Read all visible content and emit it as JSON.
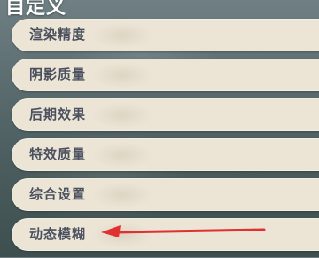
{
  "section": {
    "title": "自定义"
  },
  "menu": {
    "items": [
      {
        "label": "渲染精度"
      },
      {
        "label": "阴影质量"
      },
      {
        "label": "后期效果"
      },
      {
        "label": "特效质量"
      },
      {
        "label": "综合设置"
      },
      {
        "label": "动态模糊"
      }
    ]
  },
  "annotation": {
    "arrow_color": "#e03030",
    "points_to": "动态模糊"
  },
  "colors": {
    "item_background": "#ece5d6",
    "item_text": "#4a505e",
    "title_text": "#ffffff"
  }
}
